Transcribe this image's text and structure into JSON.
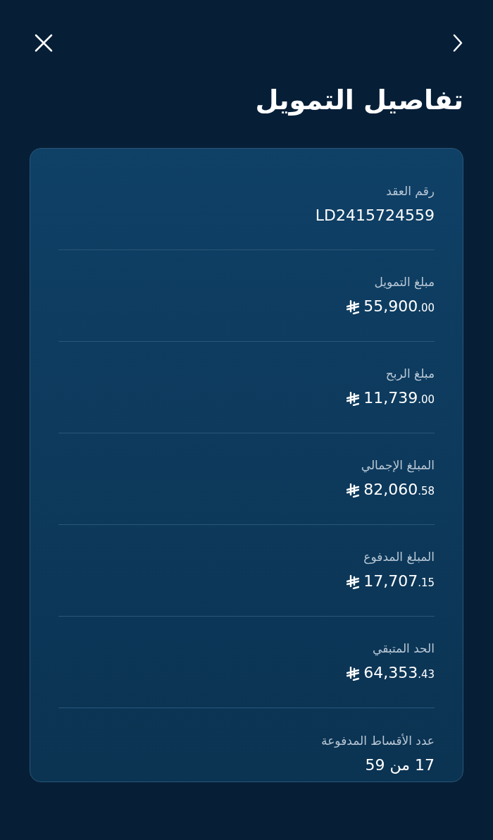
{
  "title": "تفاصيل التمويل",
  "details": [
    {
      "kind": "text",
      "label": "رقم العقد",
      "value": "LD2415724559"
    },
    {
      "kind": "amount",
      "label": "مبلغ التمويل",
      "value": "55,900",
      "decimals": ".00"
    },
    {
      "kind": "amount",
      "label": "مبلغ الربح",
      "value": "11,739",
      "decimals": ".00"
    },
    {
      "kind": "amount",
      "label": "المبلغ الإجمالي",
      "value": "82,060",
      "decimals": ".58"
    },
    {
      "kind": "amount",
      "label": "المبلغ المدفوع",
      "value": "17,707",
      "decimals": ".15"
    },
    {
      "kind": "amount",
      "label": "الحد المتبقي",
      "value": "64,353",
      "decimals": ".43"
    },
    {
      "kind": "text",
      "label": "عدد الأقساط المدفوعة",
      "value": "17 من 59"
    }
  ]
}
